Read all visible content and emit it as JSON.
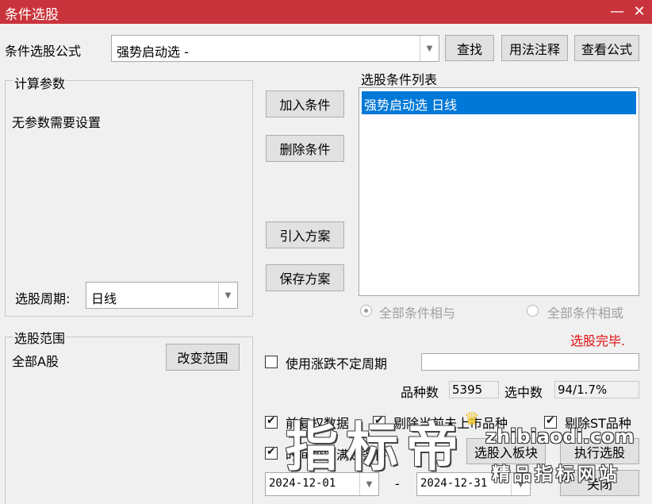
{
  "window": {
    "title": "条件选股",
    "minimize_glyph": "—",
    "close_glyph": "✕"
  },
  "formula": {
    "label": "条件选股公式",
    "selected": "强势启动选  -",
    "find_button": "查找",
    "usage_button": "用法注释",
    "view_button": "查看公式"
  },
  "params": {
    "group_title": "计算参数",
    "message": "无参数需要设置",
    "period_label": "选股周期:",
    "period_value": "日线"
  },
  "actions": {
    "add_condition": "加入条件",
    "delete_condition": "删除条件",
    "import_plan": "引入方案",
    "save_plan": "保存方案"
  },
  "conditions": {
    "list_title": "选股条件列表",
    "items": [
      "强势启动选  日线"
    ],
    "logic_and": "全部条件相与",
    "logic_or": "全部条件相或",
    "status": "选股完毕."
  },
  "scope": {
    "group_title": "选股范围",
    "value": "全部A股",
    "change_button": "改变范围"
  },
  "options": {
    "variable_period_label": "使用涨跌不定周期",
    "variable_period_value": "",
    "count_label": "品种数",
    "count_value": "5395",
    "selected_label": "选中数",
    "selected_value": "94/1.7%",
    "pre_adjust": "前复权数据",
    "exclude_current": "剔除当前未上市品种",
    "exclude_st": "剔除ST品种",
    "time_range": "时间段内满足条件",
    "select_to_board": "选股入板块",
    "execute_button": "执行选股",
    "close_button": "关闭",
    "date_from": "2024-12-01",
    "date_sep": "-",
    "date_to": "2024-12-31"
  },
  "watermark": {
    "big": "指标帝",
    "url": "zhibiaodi.com",
    "tagline": "精品指标网站"
  },
  "colors": {
    "title_bar": "#c9343c",
    "selection": "#0078d7",
    "status_text": "#e01010"
  }
}
